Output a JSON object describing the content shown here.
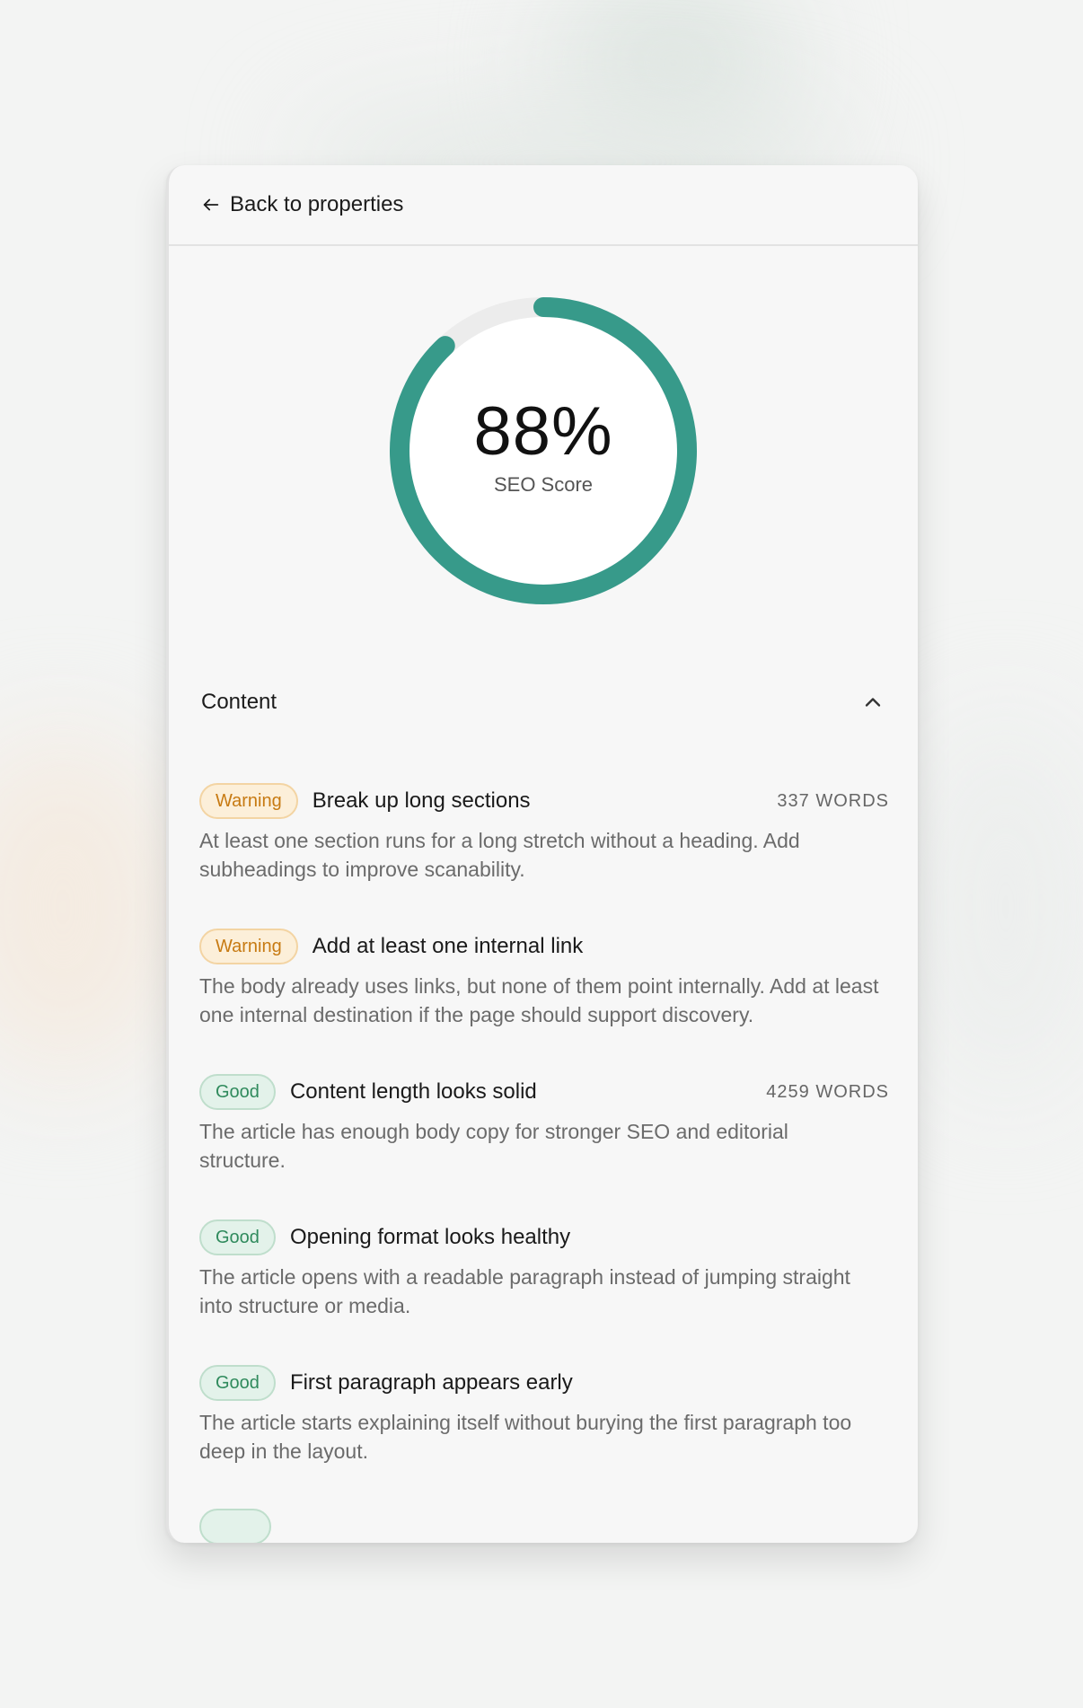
{
  "nav": {
    "back_label": "Back to properties"
  },
  "score": {
    "value": 88,
    "display": "88%",
    "label": "SEO Score",
    "color": "#379a8a",
    "track_color": "#ececec"
  },
  "section": {
    "title": "Content",
    "expanded": true
  },
  "checks": [
    {
      "status": "Warning",
      "title": "Break up long sections",
      "meta": "337 WORDS",
      "description": "At least one section runs for a long stretch without a heading. Add subheadings to improve scanability."
    },
    {
      "status": "Warning",
      "title": "Add at least one internal link",
      "meta": "",
      "description": "The body already uses links, but none of them point internally. Add at least one internal destination if the page should support discovery."
    },
    {
      "status": "Good",
      "title": "Content length looks solid",
      "meta": "4259 WORDS",
      "description": "The article has enough body copy for stronger SEO and editorial structure."
    },
    {
      "status": "Good",
      "title": "Opening format looks healthy",
      "meta": "",
      "description": "The article opens with a readable paragraph instead of jumping straight into structure or media."
    },
    {
      "status": "Good",
      "title": "First paragraph appears early",
      "meta": "",
      "description": "The article starts explaining itself without burying the first paragraph too deep in the layout."
    }
  ],
  "colors": {
    "warning": "#c77a12",
    "good": "#2f8a5c",
    "accent": "#379a8a"
  }
}
